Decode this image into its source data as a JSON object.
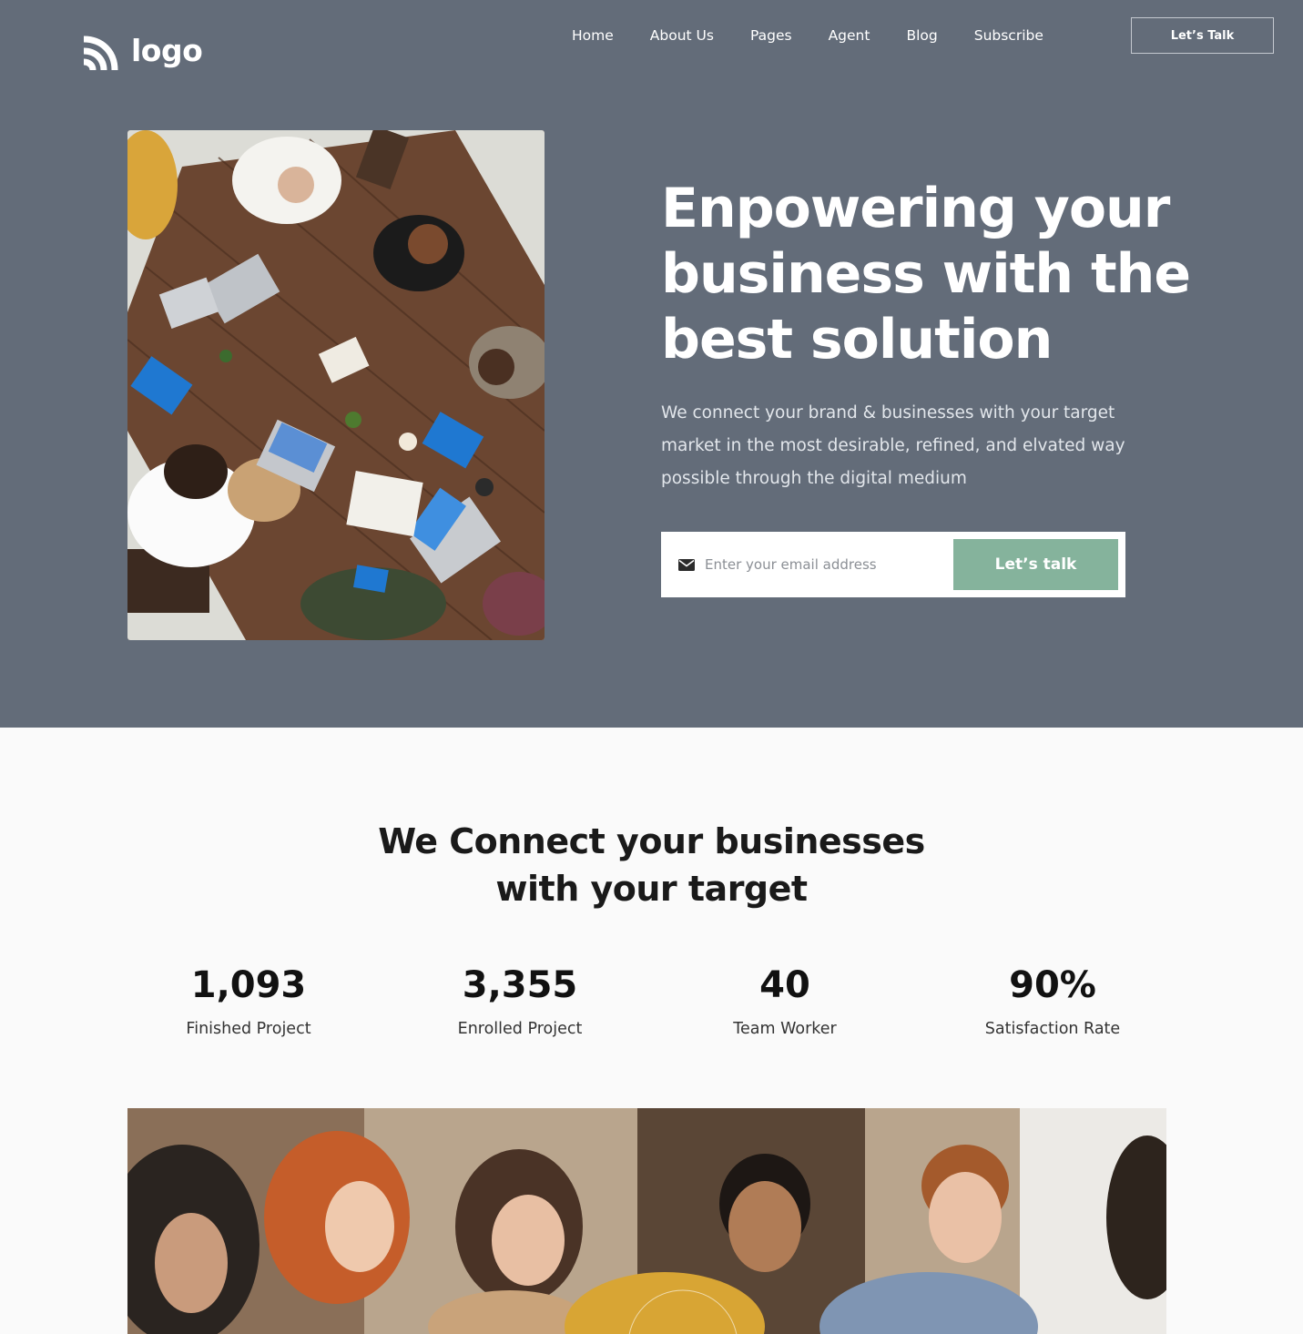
{
  "header": {
    "logo_text": "logo",
    "logo_icon": "wave-logo-icon",
    "nav": [
      "Home",
      "About Us",
      "Pages",
      "Agent",
      "Blog",
      "Subscribe"
    ],
    "cta_label": "Let’s Talk"
  },
  "hero": {
    "title": "Enpowering your business with the best solution",
    "description": "We connect your brand & businesses with your target market in the most desirable, refined, and elvated way possible through the digital medium",
    "email_placeholder": "Enter your email address",
    "email_icon": "mail-icon",
    "submit_label": "Let’s talk"
  },
  "stats_section": {
    "title_line1": "We Connect your businesses",
    "title_line2": "with your target",
    "stats": [
      {
        "value": "1,093",
        "label": "Finished Project"
      },
      {
        "value": "3,355",
        "label": "Enrolled Project"
      },
      {
        "value": "40",
        "label": "Team Worker"
      },
      {
        "value": "90%",
        "label": "Satisfaction Rate"
      }
    ]
  },
  "colors": {
    "hero_background": "#636c79",
    "accent_green": "#85b39c",
    "page_background": "#fafafa"
  }
}
